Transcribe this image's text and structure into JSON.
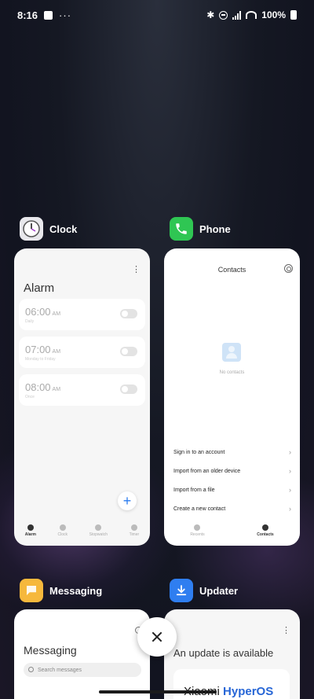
{
  "status_bar": {
    "time": "8:16",
    "battery": "100%",
    "more_glyph": "···"
  },
  "cards": {
    "clock": {
      "app_name": "Clock",
      "screen_title": "Alarm",
      "alarms": [
        {
          "time": "06:00",
          "ampm": "AM",
          "sub": "Daily"
        },
        {
          "time": "07:00",
          "ampm": "AM",
          "sub": "Monday to Friday"
        },
        {
          "time": "08:00",
          "ampm": "AM",
          "sub": "Once"
        }
      ],
      "tabs": [
        "Alarm",
        "Clock",
        "Stopwatch",
        "Timer"
      ],
      "active_tab": "Alarm"
    },
    "phone": {
      "app_name": "Phone",
      "screen_title": "Contacts",
      "empty_text": "No contacts",
      "options": [
        "Sign in to an account",
        "Import from an older device",
        "Import from a file",
        "Create a new contact"
      ],
      "tabs": [
        "Recents",
        "Contacts"
      ],
      "active_tab": "Contacts"
    },
    "messaging": {
      "app_name": "Messaging",
      "screen_title": "Messaging",
      "search_placeholder": "Search messages"
    },
    "updater": {
      "app_name": "Updater",
      "headline": "An update is available",
      "brand": "Xiaomi",
      "brand_os": "HyperOS"
    }
  },
  "colors": {
    "clock_icon_bg": "#e8e8ec",
    "phone_icon_bg": "#2fc653",
    "messaging_icon_bg": "#f6b83c",
    "updater_icon_bg": "#2f7ef0",
    "accent": "#2b7cf0"
  },
  "icons": {
    "clock": "clock-icon",
    "phone": "phone-icon",
    "messaging": "messaging-icon",
    "updater": "download-icon",
    "close": "close-icon"
  }
}
